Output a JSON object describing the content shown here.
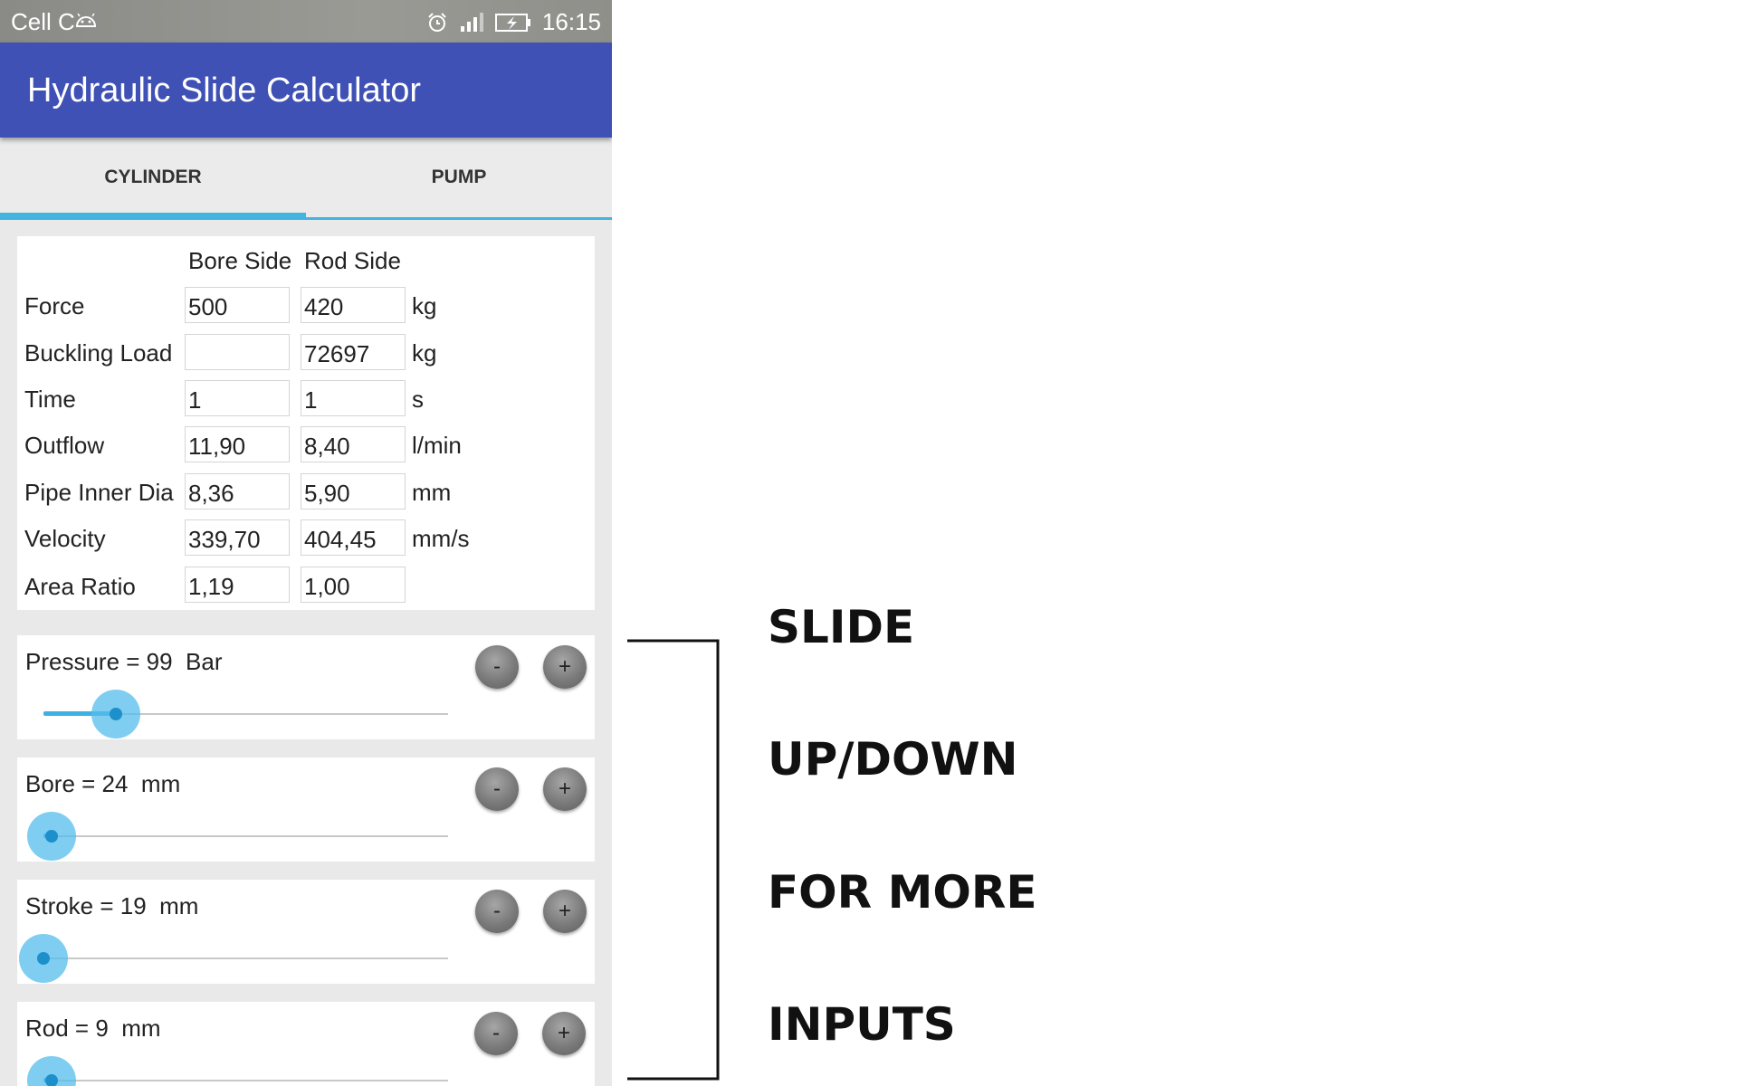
{
  "status_bar": {
    "carrier": "Cell C",
    "time": "16:15"
  },
  "app": {
    "title": "Hydraulic Slide Calculator",
    "brand_color": "#3f51b5",
    "accent_color": "#43b3e0"
  },
  "tabs": [
    {
      "label": "CYLINDER",
      "selected": true
    },
    {
      "label": "PUMP",
      "selected": false
    }
  ],
  "cylinder_table": {
    "columns": [
      "Bore Side",
      "Rod Side"
    ],
    "rows": [
      {
        "label": "Force",
        "bore": "500",
        "rod": "420",
        "unit": "kg"
      },
      {
        "label": "Buckling Load",
        "bore": "",
        "rod": "72697",
        "unit": "kg"
      },
      {
        "label": "Time",
        "bore": "1",
        "rod": "1",
        "unit": "s"
      },
      {
        "label": "Outflow",
        "bore": "11,90",
        "rod": "8,40",
        "unit": "l/min"
      },
      {
        "label": "Pipe Inner Dia",
        "bore": "8,36",
        "rod": "5,90",
        "unit": "mm"
      },
      {
        "label": "Velocity",
        "bore": "339,70",
        "rod": "404,45",
        "unit": "mm/s"
      },
      {
        "label": "Area Ratio",
        "bore": "1,19",
        "rod": "1,00",
        "unit": ""
      }
    ]
  },
  "sliders": [
    {
      "label": "Pressure = 99  Bar",
      "level_fraction": 0.18,
      "minus": "-",
      "plus": "+"
    },
    {
      "label": "Bore = 24  mm",
      "level_fraction": 0.02,
      "minus": "-",
      "plus": "+"
    },
    {
      "label": "Stroke = 19  mm",
      "level_fraction": 0.0,
      "minus": "-",
      "plus": "+"
    },
    {
      "label": "Rod = 9  mm",
      "level_fraction": 0.02,
      "minus": "-",
      "plus": "+"
    }
  ],
  "annotation": {
    "lines": [
      "SLIDE",
      "UP/DOWN",
      "FOR MORE",
      "INPUTS"
    ]
  }
}
